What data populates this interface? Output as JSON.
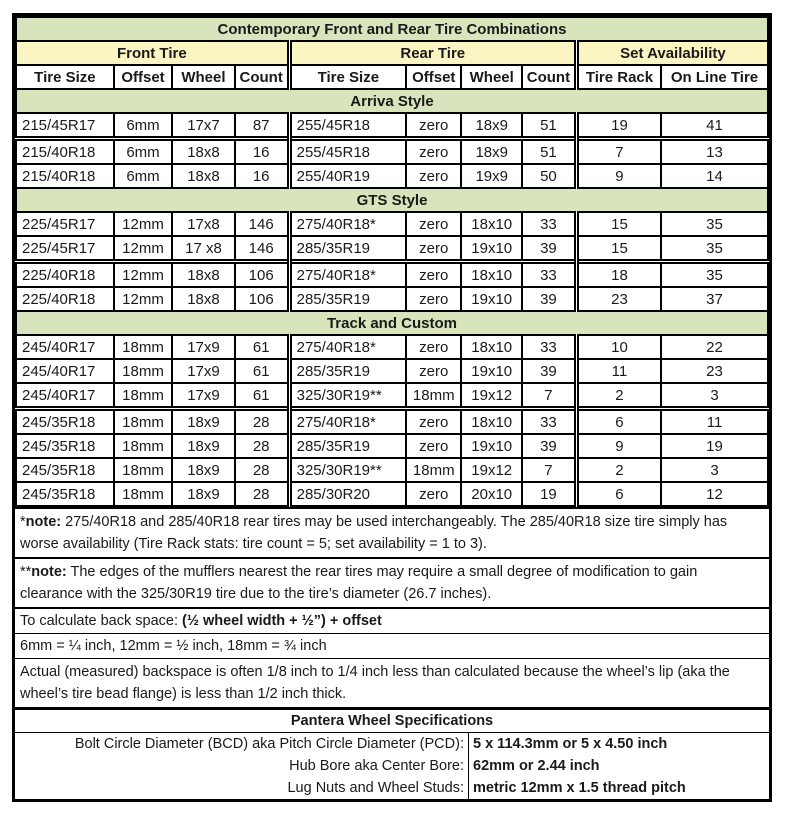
{
  "title": "Contemporary Front and Rear Tire Combinations",
  "groups": {
    "front": "Front Tire",
    "rear": "Rear Tire",
    "availability": "Set Availability"
  },
  "columns": [
    "Tire Size",
    "Offset",
    "Wheel",
    "Count",
    "Tire Size",
    "Offset",
    "Wheel",
    "Count",
    "Tire Rack",
    "On Line Tire"
  ],
  "sections": [
    {
      "name": "Arriva Style",
      "rows": [
        [
          "215/45R17",
          "6mm",
          "17x7",
          "87",
          "255/45R18",
          "zero",
          "18x9",
          "51",
          "19",
          "41"
        ],
        [
          "215/40R18",
          "6mm",
          "18x8",
          "16",
          "255/45R18",
          "zero",
          "18x9",
          "51",
          "7",
          "13"
        ],
        [
          "215/40R18",
          "6mm",
          "18x8",
          "16",
          "255/40R19",
          "zero",
          "19x9",
          "50",
          "9",
          "14"
        ]
      ]
    },
    {
      "name": "GTS Style",
      "rows": [
        [
          "225/45R17",
          "12mm",
          "17x8",
          "146",
          "275/40R18*",
          "zero",
          "18x10",
          "33",
          "15",
          "35"
        ],
        [
          "225/45R17",
          "12mm",
          "17 x8",
          "146",
          "285/35R19",
          "zero",
          "19x10",
          "39",
          "15",
          "35"
        ],
        [
          "225/40R18",
          "12mm",
          "18x8",
          "106",
          "275/40R18*",
          "zero",
          "18x10",
          "33",
          "18",
          "35"
        ],
        [
          "225/40R18",
          "12mm",
          "18x8",
          "106",
          "285/35R19",
          "zero",
          "19x10",
          "39",
          "23",
          "37"
        ]
      ]
    },
    {
      "name": "Track and Custom",
      "rows": [
        [
          "245/40R17",
          "18mm",
          "17x9",
          "61",
          "275/40R18*",
          "zero",
          "18x10",
          "33",
          "10",
          "22"
        ],
        [
          "245/40R17",
          "18mm",
          "17x9",
          "61",
          "285/35R19",
          "zero",
          "19x10",
          "39",
          "11",
          "23"
        ],
        [
          "245/40R17",
          "18mm",
          "17x9",
          "61",
          "325/30R19**",
          "18mm",
          "19x12",
          "7",
          "2",
          "3"
        ],
        [
          "245/35R18",
          "18mm",
          "18x9",
          "28",
          "275/40R18*",
          "zero",
          "18x10",
          "33",
          "6",
          "11"
        ],
        [
          "245/35R18",
          "18mm",
          "18x9",
          "28",
          "285/35R19",
          "zero",
          "19x10",
          "39",
          "9",
          "19"
        ],
        [
          "245/35R18",
          "18mm",
          "18x9",
          "28",
          "325/30R19**",
          "18mm",
          "19x12",
          "7",
          "2",
          "3"
        ],
        [
          "245/35R18",
          "18mm",
          "18x9",
          "28",
          "285/30R20",
          "zero",
          "20x10",
          "19",
          "6",
          "12"
        ]
      ]
    }
  ],
  "notes": {
    "note1_prefix": "*",
    "note1_label": "note:",
    "note1_text": " 275/40R18 and 285/40R18 rear tires may be used interchangeably. The 285/40R18 size tire simply has worse availability (Tire Rack stats: tire count = 5; set availability = 1 to 3).",
    "note2_prefix": "**",
    "note2_label": "note:",
    "note2_text": " The edges of the mufflers nearest the rear tires may require a small degree of modification to gain clearance with the 325/30R19 tire due to the tire’s diameter (26.7 inches).",
    "backspace_label": "To calculate back space: ",
    "backspace_formula": "(½ wheel width + ½”) + offset",
    "conversions": "6mm = ¼ inch, 12mm = ½ inch, 18mm = ¾ inch",
    "actual": "Actual (measured) backspace is often 1/8 inch to 1/4 inch less than calculated because the wheel’s lip (aka the wheel’s tire bead flange) is less than 1/2 inch thick."
  },
  "specs": {
    "title": "Pantera Wheel Specifications",
    "items": [
      {
        "label": "Bolt Circle Diameter (BCD)  aka Pitch Circle Diameter (PCD):",
        "value": "5 x 114.3mm or 5 x 4.50 inch"
      },
      {
        "label": "Hub Bore aka Center Bore:",
        "value": "62mm or 2.44 inch"
      },
      {
        "label": "Lug Nuts and Wheel Studs:",
        "value": "metric 12mm x 1.5 thread pitch"
      }
    ]
  }
}
